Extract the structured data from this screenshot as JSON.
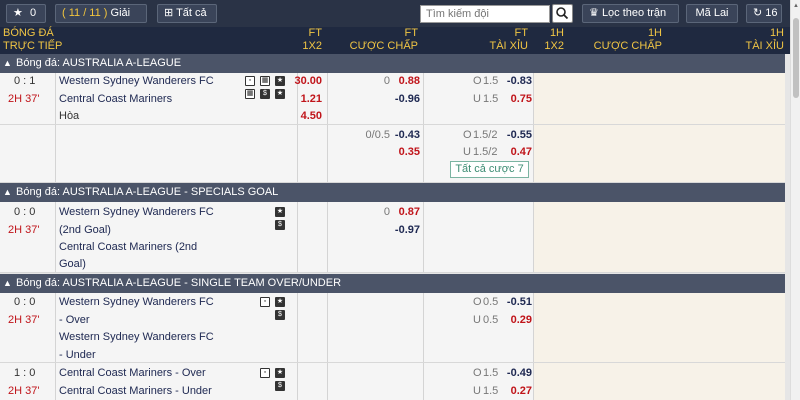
{
  "toolbar": {
    "favorites_count": "0",
    "page_indicator": "( 11 / 11 )",
    "league_select_label": "Giải",
    "all_label": "Tất cả",
    "search_placeholder": "Tìm kiếm đội",
    "filter_label": "Lọc theo trận",
    "odds_type_label": "Mã Lai",
    "refresh_count": "16"
  },
  "header": {
    "sport": "BÓNG ĐÁ",
    "live": "TRỰC TIẾP",
    "ft_1x2_top": "FT",
    "ft_1x2_bottom": "1X2",
    "ft_hdp_top": "FT",
    "ft_hdp_bottom": "CƯỢC CHẤP",
    "ft_ou_top": "FT",
    "ft_ou_bottom": "TÀI XỈU",
    "h1_1x2_top": "1H",
    "h1_1x2_bottom": "1X2",
    "h1_hdp_top": "1H",
    "h1_hdp_bottom": "CƯỢC CHẤP",
    "h1_ou_top": "1H",
    "h1_ou_bottom": "TÀI XỈU"
  },
  "leagues": [
    {
      "title": "Bóng đá: AUSTRALIA A-LEAGUE"
    },
    {
      "title": "Bóng đá: AUSTRALIA A-LEAGUE - SPECIALS GOAL"
    },
    {
      "title": "Bóng đá: AUSTRALIA A-LEAGUE - SINGLE TEAM OVER/UNDER"
    }
  ],
  "match1": {
    "score": "0 : 1",
    "time": "2H 37'",
    "home": "Western Sydney Wanderers FC",
    "away": "Central Coast Mariners",
    "draw": "Hòa",
    "x12_home": "30.00",
    "x12_away": "1.21",
    "x12_draw": "4.50",
    "hdp_line": "0",
    "hdp_home": "0.88",
    "hdp_away": "-0.96",
    "ou_over_tag": "O",
    "ou_over_line": "1.5",
    "ou_over_odds": "-0.83",
    "ou_under_tag": "U",
    "ou_under_line": "1.5",
    "ou_under_odds": "0.75",
    "alt_hdp_line": "0/0.5",
    "alt_hdp_home": "-0.43",
    "alt_hdp_away": "0.35",
    "alt_ou_over_tag": "O",
    "alt_ou_over_line": "1.5/2",
    "alt_ou_over_odds": "-0.55",
    "alt_ou_under_tag": "U",
    "alt_ou_under_line": "1.5/2",
    "alt_ou_under_odds": "0.47",
    "all_bets_label": "Tất cả cược 7"
  },
  "match2": {
    "score": "0 : 0",
    "time": "2H 37'",
    "home_l1": "Western Sydney Wanderers FC",
    "home_l2": "(2nd Goal)",
    "away_l1": "Central Coast Mariners (2nd",
    "away_l2": "Goal)",
    "hdp_line": "0",
    "hdp_home": "0.87",
    "hdp_away": "-0.97"
  },
  "match3": {
    "score": "0 : 0",
    "time": "2H 37'",
    "a_l1": "Western Sydney Wanderers FC",
    "a_l2": "- Over",
    "b_l1": "Western Sydney Wanderers FC",
    "b_l2": "- Under",
    "ou_over_tag": "O",
    "ou_over_line": "0.5",
    "ou_over_odds": "-0.51",
    "ou_under_tag": "U",
    "ou_under_line": "0.5",
    "ou_under_odds": "0.29"
  },
  "match4": {
    "score": "1 : 0",
    "time": "2H 37'",
    "a": "Central Coast Mariners - Over",
    "b": "Central Coast Mariners - Under",
    "ou_over_tag": "O",
    "ou_over_line": "1.5",
    "ou_over_odds": "-0.49",
    "ou_under_tag": "U",
    "ou_under_line": "1.5",
    "ou_under_odds": "0.27"
  },
  "icons": {
    "star": "star-icon",
    "tv": "tv-icon",
    "stats": "stats-icon",
    "cash": "cash-out-icon",
    "trophy": "trophy-icon",
    "refresh": "refresh-icon",
    "search": "search-icon",
    "plus": "plus-box-icon"
  },
  "colors": {
    "toolbar": "#2a3346",
    "header": "#1f2940",
    "header_text": "#f0c544",
    "league_bar": "#4b5468",
    "odds_red": "#c0141a",
    "odds_dark": "#202a53"
  }
}
